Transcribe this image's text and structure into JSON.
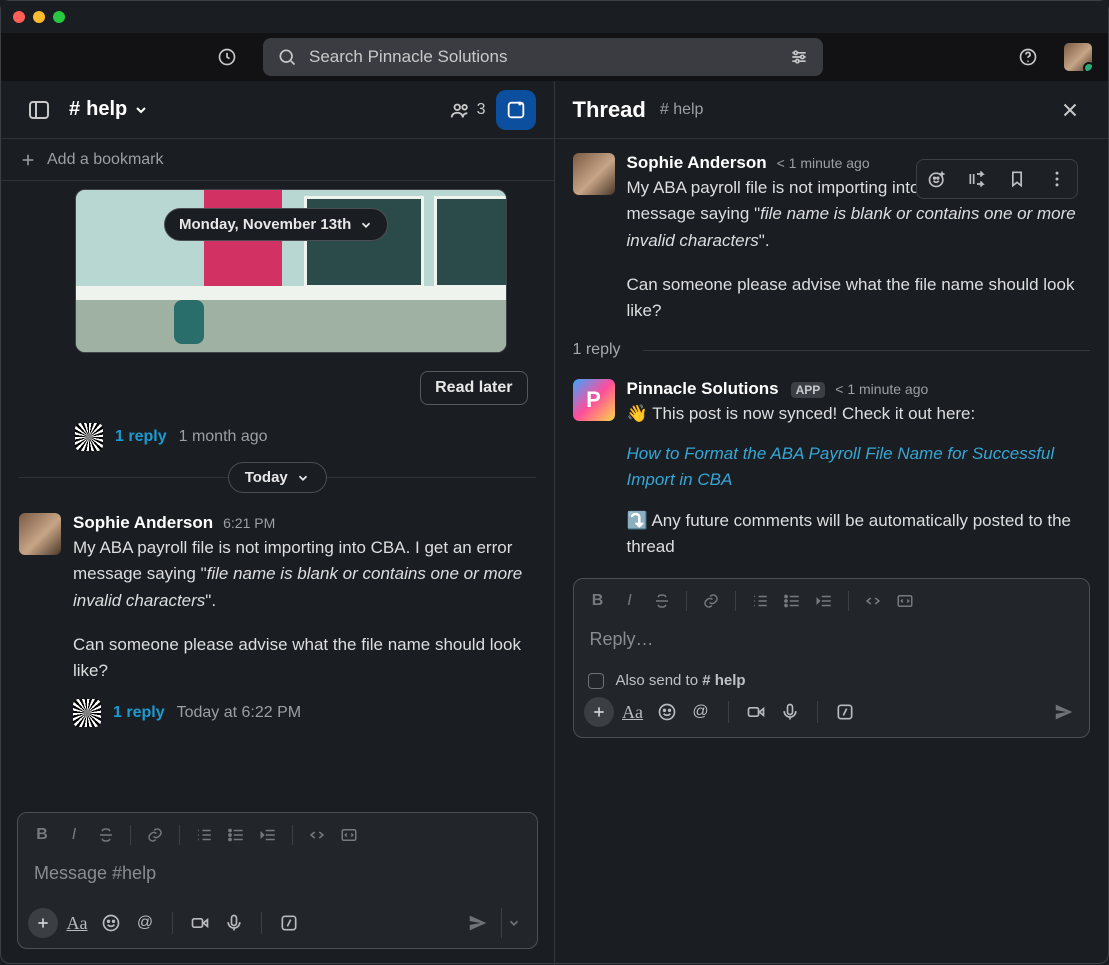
{
  "search": {
    "placeholder": "Search Pinnacle Solutions"
  },
  "channel": {
    "name": "help",
    "members": "3",
    "bookmark": "Add a bookmark",
    "date_pill": "Monday, November 13th",
    "read_later": "Read later",
    "reply1": {
      "text": "1 reply",
      "ago": "1 month ago"
    },
    "today": "Today",
    "msg": {
      "author": "Sophie Anderson",
      "time": "6:21 PM",
      "p1a": "My ABA payroll file is not importing into CBA. I get an error message saying \"",
      "p1b": "file name is blank or contains one or more invalid characters",
      "p1c": "\".",
      "p2": "Can someone please advise what the file name should look like?"
    },
    "reply2": {
      "text": "1 reply",
      "ago": "Today at 6:22 PM"
    },
    "compose_placeholder": "Message #help"
  },
  "thread": {
    "title": "Thread",
    "subtitle": "# help",
    "root": {
      "author": "Sophie Anderson",
      "time": "< 1 minute ago",
      "p1a": "My ABA payroll file is not importing into CBA. I get an error message saying \"",
      "p1b": "file name is blank or contains one or more invalid characters",
      "p1c": "\".",
      "p2": "Can someone please advise what the file name should look like?"
    },
    "count": "1 reply",
    "bot": {
      "name": "Pinnacle Solutions",
      "badge": "APP",
      "time": "< 1 minute ago",
      "l1": "👋 This post is now synced! Check it out here:",
      "link": "How to Format the ABA Payroll File Name for Successful Import in CBA",
      "l2": "⤵️ Any future comments will be automatically posted to the thread"
    },
    "reply_placeholder": "Reply…",
    "also_send_prefix": "Also send to ",
    "also_send_channel": "# help"
  }
}
